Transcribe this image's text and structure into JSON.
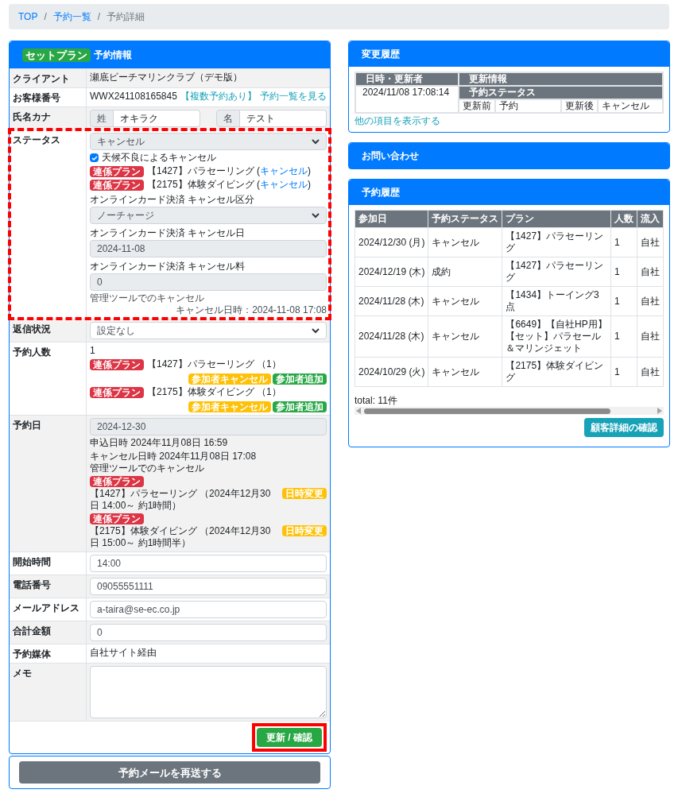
{
  "breadcrumb": [
    {
      "label": "TOP",
      "link": true
    },
    {
      "separator": "/"
    },
    {
      "label": "予約一覧",
      "link": true
    },
    {
      "separator": "/"
    },
    {
      "label": "予約詳細",
      "link": false
    }
  ],
  "reservation": {
    "badge": "セットプラン",
    "title": "予約情報",
    "rows": [
      {
        "kind": "text",
        "label": "クライアント",
        "value": "瀬底ビーチマリンクラブ（デモ版）"
      },
      {
        "kind": "customer",
        "label": "お客様番号",
        "value": "WWX241108165845",
        "links": [
          "【複数予約あり】",
          "予約一覧を見る"
        ]
      },
      {
        "kind": "name",
        "label": "氏名カナ",
        "fields": [
          {
            "prefix": "姓",
            "value": "オキラク"
          },
          {
            "prefix": "名",
            "value": "テスト"
          }
        ]
      },
      {
        "kind": "status",
        "label": "ステータス",
        "highlighted": true,
        "select": "キャンセル",
        "checkbox": {
          "label": "天候不良によるキャンセル",
          "checked": true
        },
        "linked": [
          {
            "tag": "連係プラン",
            "plan": "【1427】パラセーリング (",
            "link": "キャンセル",
            "end": ")"
          },
          {
            "tag": "連係プラン",
            "plan": "【2175】体験ダイビング (",
            "link": "キャンセル",
            "end": ")"
          }
        ],
        "fields": [
          {
            "label": "オンラインカード決済 キャンセル区分",
            "kind": "select",
            "value": "ノーチャージ"
          },
          {
            "label": "オンラインカード決済 キャンセル日",
            "kind": "input",
            "value": "2024-11-08"
          },
          {
            "label": "オンラインカード決済 キャンセル料",
            "kind": "input",
            "value": "0"
          }
        ],
        "note_left": "管理ツールでのキャンセル",
        "note_right": "キャンセル日時：2024-11-08 17:08"
      },
      {
        "kind": "select",
        "label": "返信状況",
        "value": "設定なし"
      },
      {
        "kind": "people",
        "label": "予約人数",
        "value": "1",
        "plans": [
          {
            "tag": "連係プラン",
            "plan": "【1427】パラセーリング （1）",
            "actions": [
              "参加者キャンセル",
              "参加者追加"
            ]
          },
          {
            "tag": "連係プラン",
            "plan": "【2175】体験ダイビング （1）",
            "actions": [
              "参加者キャンセル",
              "参加者追加"
            ]
          }
        ]
      },
      {
        "kind": "date",
        "label": "予約日",
        "value": "2024-12-30",
        "applied": "申込日時 2024年11月08日 16:59",
        "cancelled": [
          "キャンセル日時 2024年11月08日 17:08",
          "管理ツールでのキャンセル"
        ],
        "plans": [
          {
            "tag": "連係プラン",
            "text": "【1427】パラセーリング （2024年12月30日 14:00～ 約1時間）",
            "action": "日時変更"
          },
          {
            "tag": "連係プラン",
            "text": "【2175】体験ダイビング （2024年12月30日 15:00～ 約1時間半）",
            "action": "日時変更"
          }
        ]
      },
      {
        "kind": "input",
        "label": "開始時間",
        "value": "14:00"
      },
      {
        "kind": "input",
        "label": "電話番号",
        "value": "09055551111"
      },
      {
        "kind": "input",
        "label": "メールアドレス",
        "value": "a-taira@se-ec.co.jp"
      },
      {
        "kind": "input",
        "label": "合計金額",
        "value": "0"
      },
      {
        "kind": "text",
        "label": "予約媒体",
        "value": "自社サイト経由"
      },
      {
        "kind": "textarea",
        "label": "メモ"
      }
    ],
    "update_button": {
      "label": "更新 / 確認",
      "highlighted": true
    }
  },
  "resend_button": "予約メールを再送する",
  "change_history": {
    "title": "変更履歴",
    "columns": [
      "日時・更新者",
      "更新情報"
    ],
    "entries": [
      {
        "datetime": "2024/11/08 17:08:14",
        "field": "予約ステータス",
        "before_label": "更新前",
        "before": "予約",
        "after_label": "更新後",
        "after": "キャンセル"
      }
    ],
    "more_link": "他の項目を表示する"
  },
  "inquiry": {
    "title": "お問い合わせ"
  },
  "booking_history": {
    "title": "予約履歴",
    "columns": [
      "参加日",
      "予約ステータス",
      "プラン",
      "人数",
      "流入"
    ],
    "rows": [
      [
        "2024/12/30 (月)",
        "キャンセル",
        "【1427】パラセーリング",
        "1",
        "自社"
      ],
      [
        "2024/12/19 (木)",
        "成約",
        "【1427】パラセーリング",
        "1",
        "自社"
      ],
      [
        "2024/11/28 (木)",
        "キャンセル",
        "【1434】トーイング3点",
        "1",
        "自社"
      ],
      [
        "2024/11/28 (木)",
        "キャンセル",
        "【6649】【自社HP用】【セット】パラセール＆マリンジェット",
        "1",
        "自社"
      ],
      [
        "2024/10/29 (火)",
        "キャンセル",
        "【2175】体験ダイビング",
        "1",
        "自社"
      ]
    ],
    "total": "total: 11件",
    "button": "顧客詳細の確認"
  }
}
